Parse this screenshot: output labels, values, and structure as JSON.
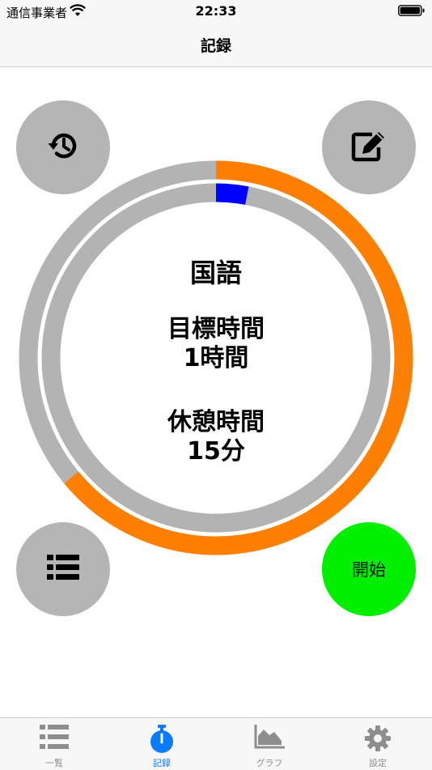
{
  "status_bar": {
    "carrier": "通信事業者",
    "time": "22:33"
  },
  "nav": {
    "title": "記録"
  },
  "timer": {
    "subject": "国語",
    "goal_label": "目標時間",
    "goal_value": "1時間",
    "rest_label": "休憩時間",
    "rest_value": "15分",
    "outer_progress": 0.64,
    "inner_progress": 0.03,
    "outer_color": "#ff8000",
    "inner_color": "#0000ff",
    "track_color": "#b3b3b3"
  },
  "buttons": {
    "history_icon": "history-icon",
    "edit_icon": "edit-icon",
    "list_icon": "list-icon",
    "start_label": "開始",
    "start_color": "#00ee00"
  },
  "tabbar": {
    "items": [
      {
        "label": "一覧",
        "icon": "list-icon"
      },
      {
        "label": "記録",
        "icon": "stopwatch-icon",
        "active": true
      },
      {
        "label": "グラフ",
        "icon": "area-chart-icon"
      },
      {
        "label": "設定",
        "icon": "gear-icon"
      }
    ],
    "active_color": "#0a7aff"
  }
}
